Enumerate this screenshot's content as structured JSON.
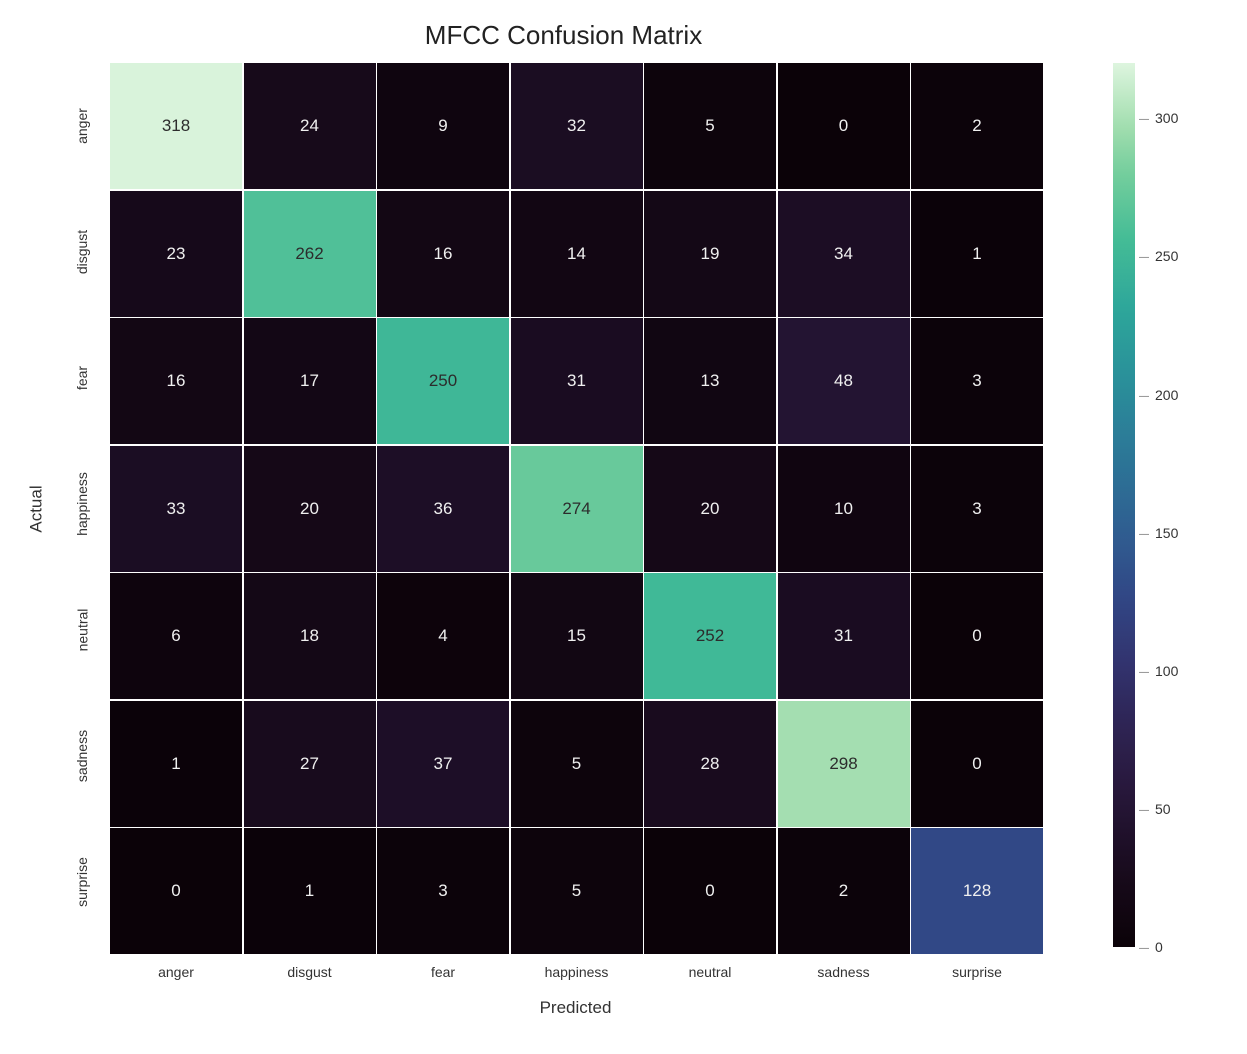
{
  "chart_data": {
    "type": "heatmap",
    "title": "MFCC Confusion Matrix",
    "xlabel": "Predicted",
    "ylabel": "Actual",
    "categories": [
      "anger",
      "disgust",
      "fear",
      "happiness",
      "neutral",
      "sadness",
      "surprise"
    ],
    "matrix": [
      [
        318,
        24,
        9,
        32,
        5,
        0,
        2
      ],
      [
        23,
        262,
        16,
        14,
        19,
        34,
        1
      ],
      [
        16,
        17,
        250,
        31,
        13,
        48,
        3
      ],
      [
        33,
        20,
        36,
        274,
        20,
        10,
        3
      ],
      [
        6,
        18,
        4,
        15,
        252,
        31,
        0
      ],
      [
        1,
        27,
        37,
        5,
        28,
        298,
        0
      ],
      [
        0,
        1,
        3,
        5,
        0,
        2,
        128
      ]
    ],
    "colorbar_ticks": [
      0,
      50,
      100,
      150,
      200,
      250,
      300
    ],
    "vmin": 0,
    "vmax": 320,
    "cmap": "mako"
  }
}
